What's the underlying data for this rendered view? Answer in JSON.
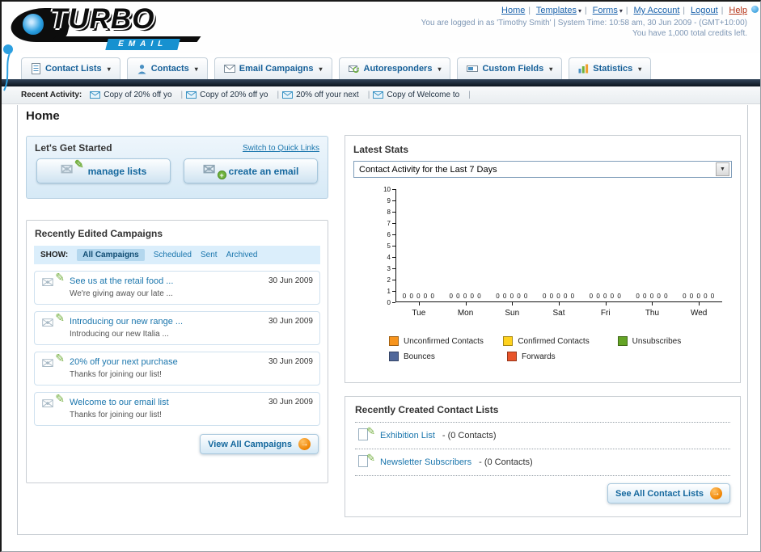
{
  "icons": {
    "chevron_down": "▾",
    "select_arrow": "▼",
    "arrow_right": "→",
    "envelope": "✉",
    "pencil": "✎",
    "plus": "+"
  },
  "header": {
    "logo_title": "TURBO",
    "logo_subtitle": "EMAIL",
    "nav_links": [
      {
        "label": "Home",
        "dropdown": false
      },
      {
        "label": "Templates",
        "dropdown": true
      },
      {
        "label": "Forms",
        "dropdown": true
      },
      {
        "label": "My Account",
        "dropdown": false
      },
      {
        "label": "Logout",
        "dropdown": false
      },
      {
        "label": "Help",
        "dropdown": false
      }
    ],
    "login_info": "You are logged in as 'Timothy Smith' | System Time: 10:58 am, 30 Jun 2009 - (GMT+10:00)",
    "credits_info": "You have 1,000 total credits left."
  },
  "main_nav": {
    "items": [
      {
        "label": "Contact Lists"
      },
      {
        "label": "Contacts"
      },
      {
        "label": "Email Campaigns"
      },
      {
        "label": "Autoresponders"
      },
      {
        "label": "Custom Fields"
      },
      {
        "label": "Statistics"
      }
    ]
  },
  "recent_activity": {
    "label": "Recent Activity:",
    "items": [
      "Copy of 20% off yo",
      "Copy of 20% off yo",
      "20% off your next",
      "Copy of Welcome to"
    ]
  },
  "page": {
    "title": "Home"
  },
  "get_started": {
    "title": "Let's Get Started",
    "switch_link": "Switch to Quick Links",
    "manage_lists_label": "manage lists",
    "create_email_label": "create an email"
  },
  "campaigns": {
    "title": "Recently Edited Campaigns",
    "show_label": "SHOW:",
    "tabs": [
      "All Campaigns",
      "Scheduled",
      "Sent",
      "Archived"
    ],
    "items": [
      {
        "title": "See us at the retail food ...",
        "subtitle": "We're giving away our late ...",
        "date": "30 Jun 2009"
      },
      {
        "title": "Introducing our new range ...",
        "subtitle": "Introducing our new Italia ...",
        "date": "30 Jun 2009"
      },
      {
        "title": "20% off your next purchase",
        "subtitle": "Thanks for joining our list!",
        "date": "30 Jun 2009"
      },
      {
        "title": "Welcome to our email list",
        "subtitle": "Thanks for joining our list!",
        "date": "30 Jun 2009"
      }
    ],
    "view_all_label": "View All Campaigns"
  },
  "latest_stats": {
    "title": "Latest Stats",
    "dropdown_value": "Contact Activity for the Last 7 Days",
    "chart_data": {
      "type": "bar",
      "title": "Contact Activity for the Last 7 Days",
      "categories": [
        "Tue",
        "Mon",
        "Sun",
        "Sat",
        "Fri",
        "Thu",
        "Wed"
      ],
      "series": [
        {
          "name": "Unconfirmed Contacts",
          "color": "#f7941d",
          "values": [
            0,
            0,
            0,
            0,
            0,
            0,
            0
          ]
        },
        {
          "name": "Confirmed Contacts",
          "color": "#ffd21e",
          "values": [
            0,
            0,
            0,
            0,
            0,
            0,
            0
          ]
        },
        {
          "name": "Unsubscribes",
          "color": "#64a425",
          "values": [
            0,
            0,
            0,
            0,
            0,
            0,
            0
          ]
        },
        {
          "name": "Bounces",
          "color": "#51689b",
          "values": [
            0,
            0,
            0,
            0,
            0,
            0,
            0
          ]
        },
        {
          "name": "Forwards",
          "color": "#e8542a",
          "values": [
            0,
            0,
            0,
            0,
            0,
            0,
            0
          ]
        }
      ],
      "ylim": [
        0,
        10
      ],
      "yticks": [
        0,
        1,
        2,
        3,
        4,
        5,
        6,
        7,
        8,
        9,
        10
      ],
      "grid": false,
      "legend_position": "bottom"
    }
  },
  "contact_lists": {
    "title": "Recently Created Contact Lists",
    "items": [
      {
        "name": "Exhibition List",
        "detail": "- (0 Contacts)"
      },
      {
        "name": "Newsletter Subscribers",
        "detail": "- (0 Contacts)"
      }
    ],
    "see_all_label": "See All Contact Lists"
  }
}
